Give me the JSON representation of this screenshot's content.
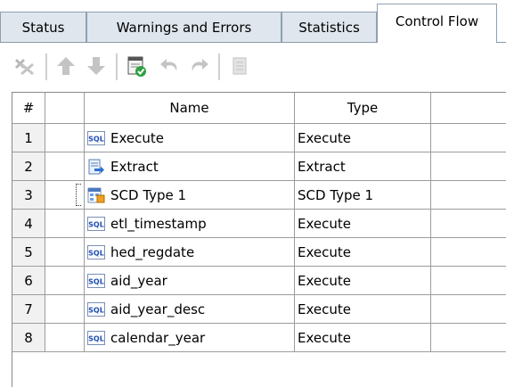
{
  "tabs": [
    {
      "label": "Status"
    },
    {
      "label": "Warnings and Errors"
    },
    {
      "label": "Statistics"
    },
    {
      "label": "Control Flow"
    }
  ],
  "active_tab": "Control Flow",
  "toolbar": {
    "icons": [
      "remove-icon",
      "move-up-icon",
      "move-down-icon",
      "validate-icon",
      "undo-icon",
      "redo-icon",
      "properties-icon"
    ]
  },
  "grid": {
    "headers": {
      "number": "#",
      "select": "",
      "name": "Name",
      "type": "Type",
      "extra": ""
    },
    "rows": [
      {
        "number": "1",
        "icon": "sql-icon",
        "name": "Execute",
        "type": "Execute"
      },
      {
        "number": "2",
        "icon": "extract-icon",
        "name": "Extract",
        "type": "Extract"
      },
      {
        "number": "3",
        "icon": "scd-icon",
        "name": "SCD Type 1",
        "type": "SCD Type 1",
        "focused": true
      },
      {
        "number": "4",
        "icon": "sql-icon",
        "name": "etl_timestamp",
        "type": "Execute"
      },
      {
        "number": "5",
        "icon": "sql-icon",
        "name": "hed_regdate",
        "type": "Execute"
      },
      {
        "number": "6",
        "icon": "sql-icon",
        "name": "aid_year",
        "type": "Execute"
      },
      {
        "number": "7",
        "icon": "sql-icon",
        "name": "aid_year_desc",
        "type": "Execute"
      },
      {
        "number": "8",
        "icon": "sql-icon",
        "name": "calendar_year",
        "type": "Execute"
      }
    ]
  },
  "colors": {
    "tab_inactive": "#dfe6ee",
    "tab_active": "#ffffff",
    "grid_line": "#9c9c9c",
    "sql_icon_blue": "#1f4fb4"
  }
}
